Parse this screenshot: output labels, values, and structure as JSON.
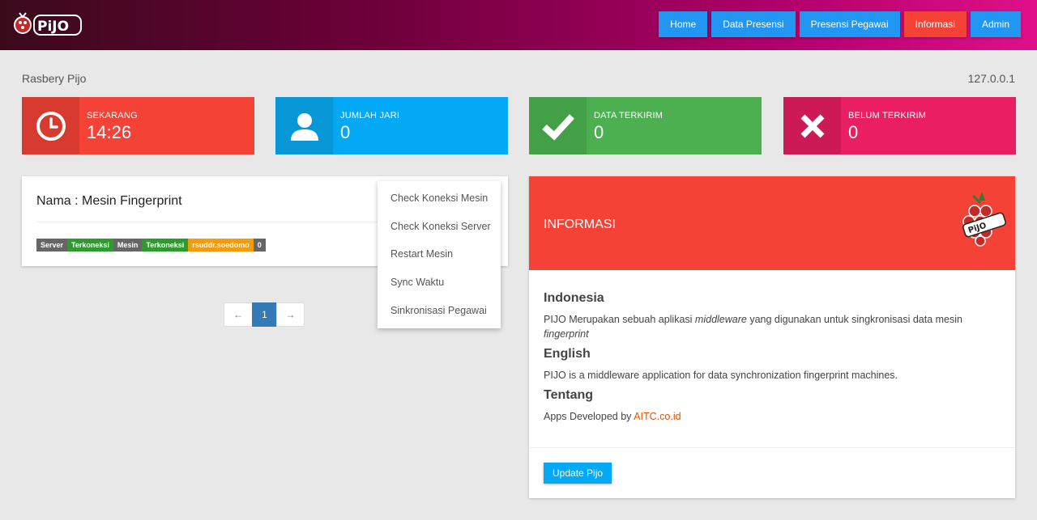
{
  "brand": {
    "logo_text": "PiJO"
  },
  "nav": [
    {
      "label": "Home",
      "color": "#2196f3"
    },
    {
      "label": "Data Presensi",
      "color": "#2196f3"
    },
    {
      "label": "Presensi Pegawai",
      "color": "#2196f3"
    },
    {
      "label": "Informasi",
      "color": "#f44336"
    },
    {
      "label": "Admin",
      "color": "#2196f3"
    }
  ],
  "subheader": {
    "device_name": "Rasbery Pijo",
    "ip": "127.0.0.1"
  },
  "stats": [
    {
      "label": "SEKARANG",
      "value": "14:26",
      "icon": "clock-icon",
      "color": "#f44336",
      "icon_bg": "#d73a2f"
    },
    {
      "label": "JUMLAH JARI",
      "value": "0",
      "icon": "user-icon",
      "color": "#03a9f4",
      "icon_bg": "#0897d6"
    },
    {
      "label": "DATA TERKIRIM",
      "value": "0",
      "icon": "check-icon",
      "color": "#4caf50",
      "icon_bg": "#43a047"
    },
    {
      "label": "BELUM TERKIRIM",
      "value": "0",
      "icon": "x-icon",
      "color": "#e91e63",
      "icon_bg": "#cc1a57"
    }
  ],
  "machine": {
    "title": "Nama : Mesin Fingerprint",
    "badges": [
      {
        "text": "Server",
        "color": "#666666"
      },
      {
        "text": "Terkoneksi",
        "color": "#2e9b2e"
      },
      {
        "text": "Mesin",
        "color": "#666666"
      },
      {
        "text": "Terkoneksi",
        "color": "#2e9b2e"
      },
      {
        "text": "rsuddr.soedomo",
        "color": "#f39c12"
      },
      {
        "text": "0",
        "color": "#666666"
      }
    ]
  },
  "dropdown": {
    "items": [
      "Check Koneksi Mesin",
      "Check Koneksi Server",
      "Restart Mesin",
      "Sync Waktu",
      "Sinkronisasi Pegawai"
    ]
  },
  "pagination": {
    "prev": "←",
    "current": "1",
    "next": "→"
  },
  "info_panel": {
    "title": "INFORMASI",
    "sections": {
      "indonesia": {
        "heading": "Indonesia",
        "text_before": "PIJO Merupakan sebuah aplikasi ",
        "em1": "middleware",
        "text_middle": " yang digunakan untuk singkronisasi data mesin ",
        "em2": "fingerprint"
      },
      "english": {
        "heading": "English",
        "text": "PIJO is a middleware application for data synchronization fingerprint machines."
      },
      "tentang": {
        "heading": "Tentang",
        "text": "Apps Developed by ",
        "link": "AITC.co.id"
      }
    },
    "update_button": "Update Pijo"
  }
}
